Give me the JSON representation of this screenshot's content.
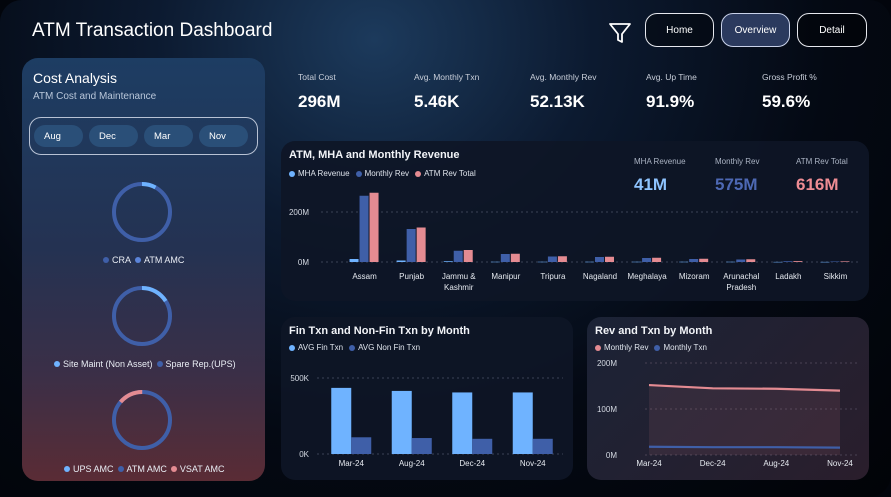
{
  "header": {
    "title": "ATM Transaction Dashboard",
    "nav": [
      "Home",
      "Overview",
      "Detail"
    ],
    "active_nav": "Overview"
  },
  "cost_panel": {
    "title": "Cost Analysis",
    "subtitle": "ATM Cost and Maintenance",
    "months": [
      "Aug",
      "Dec",
      "Mar",
      "Nov"
    ],
    "donuts": [
      {
        "legend": [
          "CRA",
          "ATM AMC"
        ],
        "colors": [
          "#3f5fa8",
          "#5b84d9"
        ],
        "share": 0.08
      },
      {
        "legend": [
          "Site Maint (Non Asset)",
          "Spare Rep.(UPS)"
        ],
        "colors": [
          "#6fb3ff",
          "#3f5fa8"
        ],
        "share": 0.16
      },
      {
        "legend": [
          "UPS AMC",
          "ATM AMC",
          "VSAT AMC"
        ],
        "colors": [
          "#6fb3ff",
          "#3f5fa8",
          "#e48b92"
        ],
        "share": 0.14
      }
    ]
  },
  "kpis": [
    {
      "label": "Total Cost",
      "value": "296M"
    },
    {
      "label": "Avg. Monthly Txn",
      "value": "5.46K"
    },
    {
      "label": "Avg. Monthly Rev",
      "value": "52.13K"
    },
    {
      "label": "Avg. Up Time",
      "value": "91.9%"
    },
    {
      "label": "Gross Profit %",
      "value": "59.6%"
    }
  ],
  "colors": {
    "light_blue": "#6fb3ff",
    "blue": "#3f5fa8",
    "pink": "#e48b92"
  },
  "chart_data": [
    {
      "type": "bar",
      "title": "ATM, MHA and Monthly Revenue",
      "categories": [
        "Assam",
        "Punjab",
        "Jammu & Kashmir",
        "Manipur",
        "Tripura",
        "Nagaland",
        "Meghalaya",
        "Mizoram",
        "Arunachal Pradesh",
        "Ladakh",
        "Sikkim"
      ],
      "series": [
        {
          "name": "MHA Revenue",
          "values": [
            12,
            6,
            3,
            1,
            1,
            1,
            1,
            1,
            1,
            0.5,
            0.5
          ]
        },
        {
          "name": "Monthly Rev",
          "values": [
            265,
            132,
            45,
            32,
            22,
            20,
            16,
            12,
            10,
            3,
            2
          ]
        },
        {
          "name": "ATM Rev Total",
          "values": [
            277,
            138,
            48,
            33,
            23,
            21,
            17,
            13,
            11,
            3.5,
            2.5
          ]
        }
      ],
      "yticks": [
        "200M",
        "0M"
      ],
      "ylim": [
        0,
        300
      ],
      "summary": [
        {
          "label": "MHA Revenue",
          "value": "41M"
        },
        {
          "label": "Monthly Rev",
          "value": "575M"
        },
        {
          "label": "ATM Rev Total",
          "value": "616M"
        }
      ]
    },
    {
      "type": "bar",
      "title": "Fin Txn and Non-Fin Txn by Month",
      "categories": [
        "Mar-24",
        "Aug-24",
        "Dec-24",
        "Nov-24"
      ],
      "series": [
        {
          "name": "AVG Fin Txn",
          "values": [
            435,
            415,
            405,
            405
          ]
        },
        {
          "name": "AVG Non Fin Txn",
          "values": [
            110,
            105,
            100,
            100
          ]
        }
      ],
      "yticks": [
        "500K",
        "0K"
      ],
      "ylim": [
        0,
        500
      ]
    },
    {
      "type": "line",
      "title": "Rev and Txn by Month",
      "categories": [
        "Mar-24",
        "Dec-24",
        "Aug-24",
        "Nov-24"
      ],
      "series": [
        {
          "name": "Monthly Rev",
          "values": [
            152,
            145,
            144,
            140
          ]
        },
        {
          "name": "Monthly Txn",
          "values": [
            18,
            17,
            17,
            16
          ]
        }
      ],
      "yticks": [
        "200M",
        "100M",
        "0M"
      ],
      "ylim": [
        0,
        200
      ]
    }
  ]
}
